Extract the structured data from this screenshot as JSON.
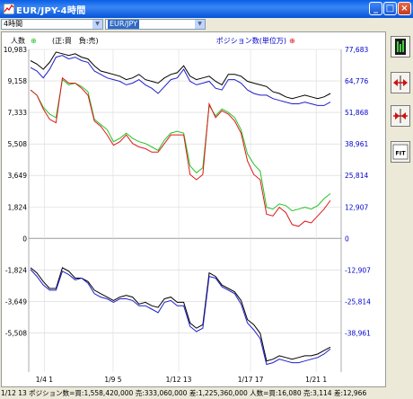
{
  "window": {
    "title": "EUR/JPY-4時間"
  },
  "controls": {
    "timeframe": "4時間",
    "pair": "EUR/JPY"
  },
  "legend": {
    "left_label": "人数",
    "left_badge": "⊕",
    "sign_note": "(正:買　負:売)",
    "right_label": "ポジション数(単位万)",
    "right_badge": "⊕"
  },
  "colors": {
    "black_line": "#000000",
    "blue_line": "#1f1fcc",
    "green_line": "#22c422",
    "red_line": "#e01818",
    "right_axis_text": "#0000cc",
    "grid": "#b0b0b0"
  },
  "icons": [
    "bar-chart-icon",
    "expand-horizontal-icon",
    "shrink-horizontal-icon",
    "fit-icon"
  ],
  "side_labels": {
    "fit": "FIT"
  },
  "chart_data": {
    "type": "line",
    "y_left_ticks": [
      "10,983",
      "9,158",
      "7,333",
      "5,508",
      "3,649",
      "1,824",
      "0",
      "-1,824",
      "-3,649",
      "-5,508"
    ],
    "y_right_ticks": [
      "77,683",
      "64,776",
      "51,868",
      "38,961",
      "25,814",
      "12,907",
      "0",
      "-12,907",
      "-25,814",
      "-38,961"
    ],
    "x_ticks": [
      "1/4 1",
      "1/9 5",
      "1/12 13",
      "1/17 17",
      "1/21 1"
    ],
    "ylim": [
      -7333,
      10983
    ],
    "series": [
      {
        "name": "black",
        "color": "#000000",
        "values": [
          10300,
          10100,
          9800,
          10200,
          10800,
          10700,
          10600,
          10700,
          10500,
          10400,
          10000,
          9700,
          9600,
          9500,
          9400,
          9200,
          9300,
          9500,
          9200,
          9100,
          9000,
          9300,
          9500,
          9600,
          10000,
          9400,
          9200,
          9300,
          9400,
          9100,
          8900,
          9500,
          9500,
          9400,
          9100,
          9000,
          8900,
          8800,
          8500,
          8400,
          8200,
          8100,
          8200,
          8300,
          8200,
          8100,
          8200,
          8400
        ]
      },
      {
        "name": "blue",
        "color": "#1f1fcc",
        "values": [
          9900,
          9700,
          9300,
          9800,
          10500,
          10600,
          10400,
          10500,
          10300,
          10200,
          9700,
          9500,
          9300,
          9200,
          9100,
          8900,
          9000,
          9200,
          8900,
          8700,
          8400,
          8800,
          9200,
          9300,
          9800,
          9100,
          8900,
          9000,
          9100,
          8700,
          8600,
          9200,
          9200,
          9000,
          8600,
          8400,
          8300,
          8300,
          8100,
          8000,
          7900,
          7800,
          7800,
          7900,
          7800,
          7700,
          7700,
          7900
        ]
      },
      {
        "name": "green",
        "color": "#22c422",
        "values": [
          8600,
          8300,
          7600,
          7200,
          7000,
          9200,
          8900,
          9000,
          8800,
          8500,
          6900,
          6600,
          6300,
          5600,
          5800,
          6100,
          5800,
          5600,
          5500,
          5300,
          5100,
          5700,
          6100,
          6200,
          6100,
          4200,
          3800,
          4100,
          7700,
          7100,
          7500,
          7300,
          7000,
          6300,
          4900,
          4300,
          3900,
          1800,
          1700,
          2000,
          1900,
          1600,
          1700,
          1800,
          1700,
          1900,
          2300,
          2600
        ]
      },
      {
        "name": "red",
        "color": "#e01818",
        "values": [
          8600,
          8300,
          7500,
          6900,
          6700,
          9300,
          9000,
          9000,
          8700,
          8300,
          6800,
          6500,
          6000,
          5400,
          5600,
          6000,
          5500,
          5300,
          5200,
          5000,
          5000,
          5500,
          6000,
          6000,
          6000,
          3700,
          3400,
          3700,
          7800,
          7000,
          7400,
          7200,
          6800,
          6100,
          4500,
          3700,
          3400,
          1400,
          1300,
          1800,
          1500,
          800,
          700,
          1000,
          900,
          1300,
          1700,
          2200
        ]
      },
      {
        "name": "black-lower",
        "color": "#000000",
        "values": [
          -1700,
          -2000,
          -2500,
          -2900,
          -2900,
          -1700,
          -1900,
          -2300,
          -2300,
          -2500,
          -3000,
          -3200,
          -3400,
          -3600,
          -3400,
          -3300,
          -3400,
          -3800,
          -3700,
          -3900,
          -4000,
          -3500,
          -3400,
          -3700,
          -3700,
          -4900,
          -5200,
          -5000,
          -2000,
          -2200,
          -2700,
          -2900,
          -3100,
          -3600,
          -4700,
          -5000,
          -5500,
          -7100,
          -7000,
          -6800,
          -6900,
          -7000,
          -6900,
          -6800,
          -6800,
          -6700,
          -6500,
          -6300
        ]
      },
      {
        "name": "blue-lower",
        "color": "#1f1fcc",
        "values": [
          -1800,
          -2200,
          -2700,
          -3000,
          -3000,
          -1900,
          -2100,
          -2400,
          -2300,
          -2600,
          -3200,
          -3400,
          -3500,
          -3700,
          -3500,
          -3500,
          -3600,
          -3900,
          -3900,
          -4100,
          -4300,
          -3700,
          -3600,
          -3900,
          -3900,
          -5100,
          -5400,
          -5200,
          -2200,
          -2300,
          -2800,
          -3000,
          -3200,
          -3800,
          -4900,
          -5300,
          -5800,
          -7300,
          -7200,
          -7000,
          -7100,
          -7200,
          -7200,
          -7100,
          -7000,
          -6900,
          -6700,
          -6400
        ]
      }
    ],
    "grid": true
  },
  "status": {
    "text": "1/12 13  ポジション数=買:1,558,420,000 売:333,060,000 差:1,225,360,000  人数=買:16,080 売:3,114 差:12,966"
  }
}
